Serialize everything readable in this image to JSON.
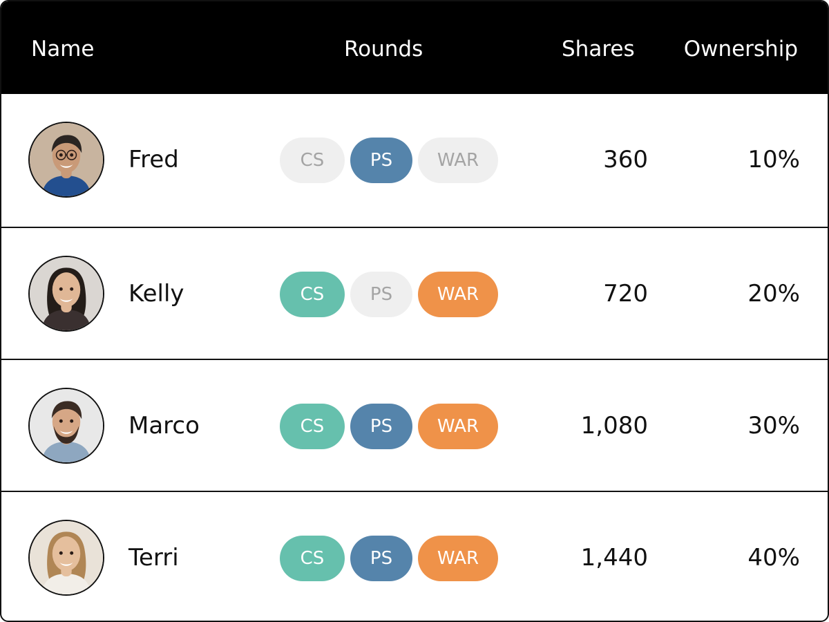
{
  "columns": {
    "name": "Name",
    "rounds": "Rounds",
    "shares": "Shares",
    "ownership": "Ownership"
  },
  "round_labels": {
    "cs": "CS",
    "ps": "PS",
    "war": "WAR"
  },
  "colors": {
    "cs": "#66c0ad",
    "ps": "#5584ab",
    "war": "#ef9249",
    "inactive_bg": "#efefef",
    "inactive_text": "#a4a4a4",
    "header_bg": "#000000"
  },
  "rows": [
    {
      "name": "Fred",
      "avatar": "avatar-icon",
      "rounds": {
        "cs": false,
        "ps": true,
        "war": false
      },
      "shares": "360",
      "ownership": "10%"
    },
    {
      "name": "Kelly",
      "avatar": "avatar-icon",
      "rounds": {
        "cs": true,
        "ps": false,
        "war": true
      },
      "shares": "720",
      "ownership": "20%"
    },
    {
      "name": "Marco",
      "avatar": "avatar-icon",
      "rounds": {
        "cs": true,
        "ps": true,
        "war": true
      },
      "shares": "1,080",
      "ownership": "30%"
    },
    {
      "name": "Terri",
      "avatar": "avatar-icon",
      "rounds": {
        "cs": true,
        "ps": true,
        "war": true
      },
      "shares": "1,440",
      "ownership": "40%"
    }
  ]
}
